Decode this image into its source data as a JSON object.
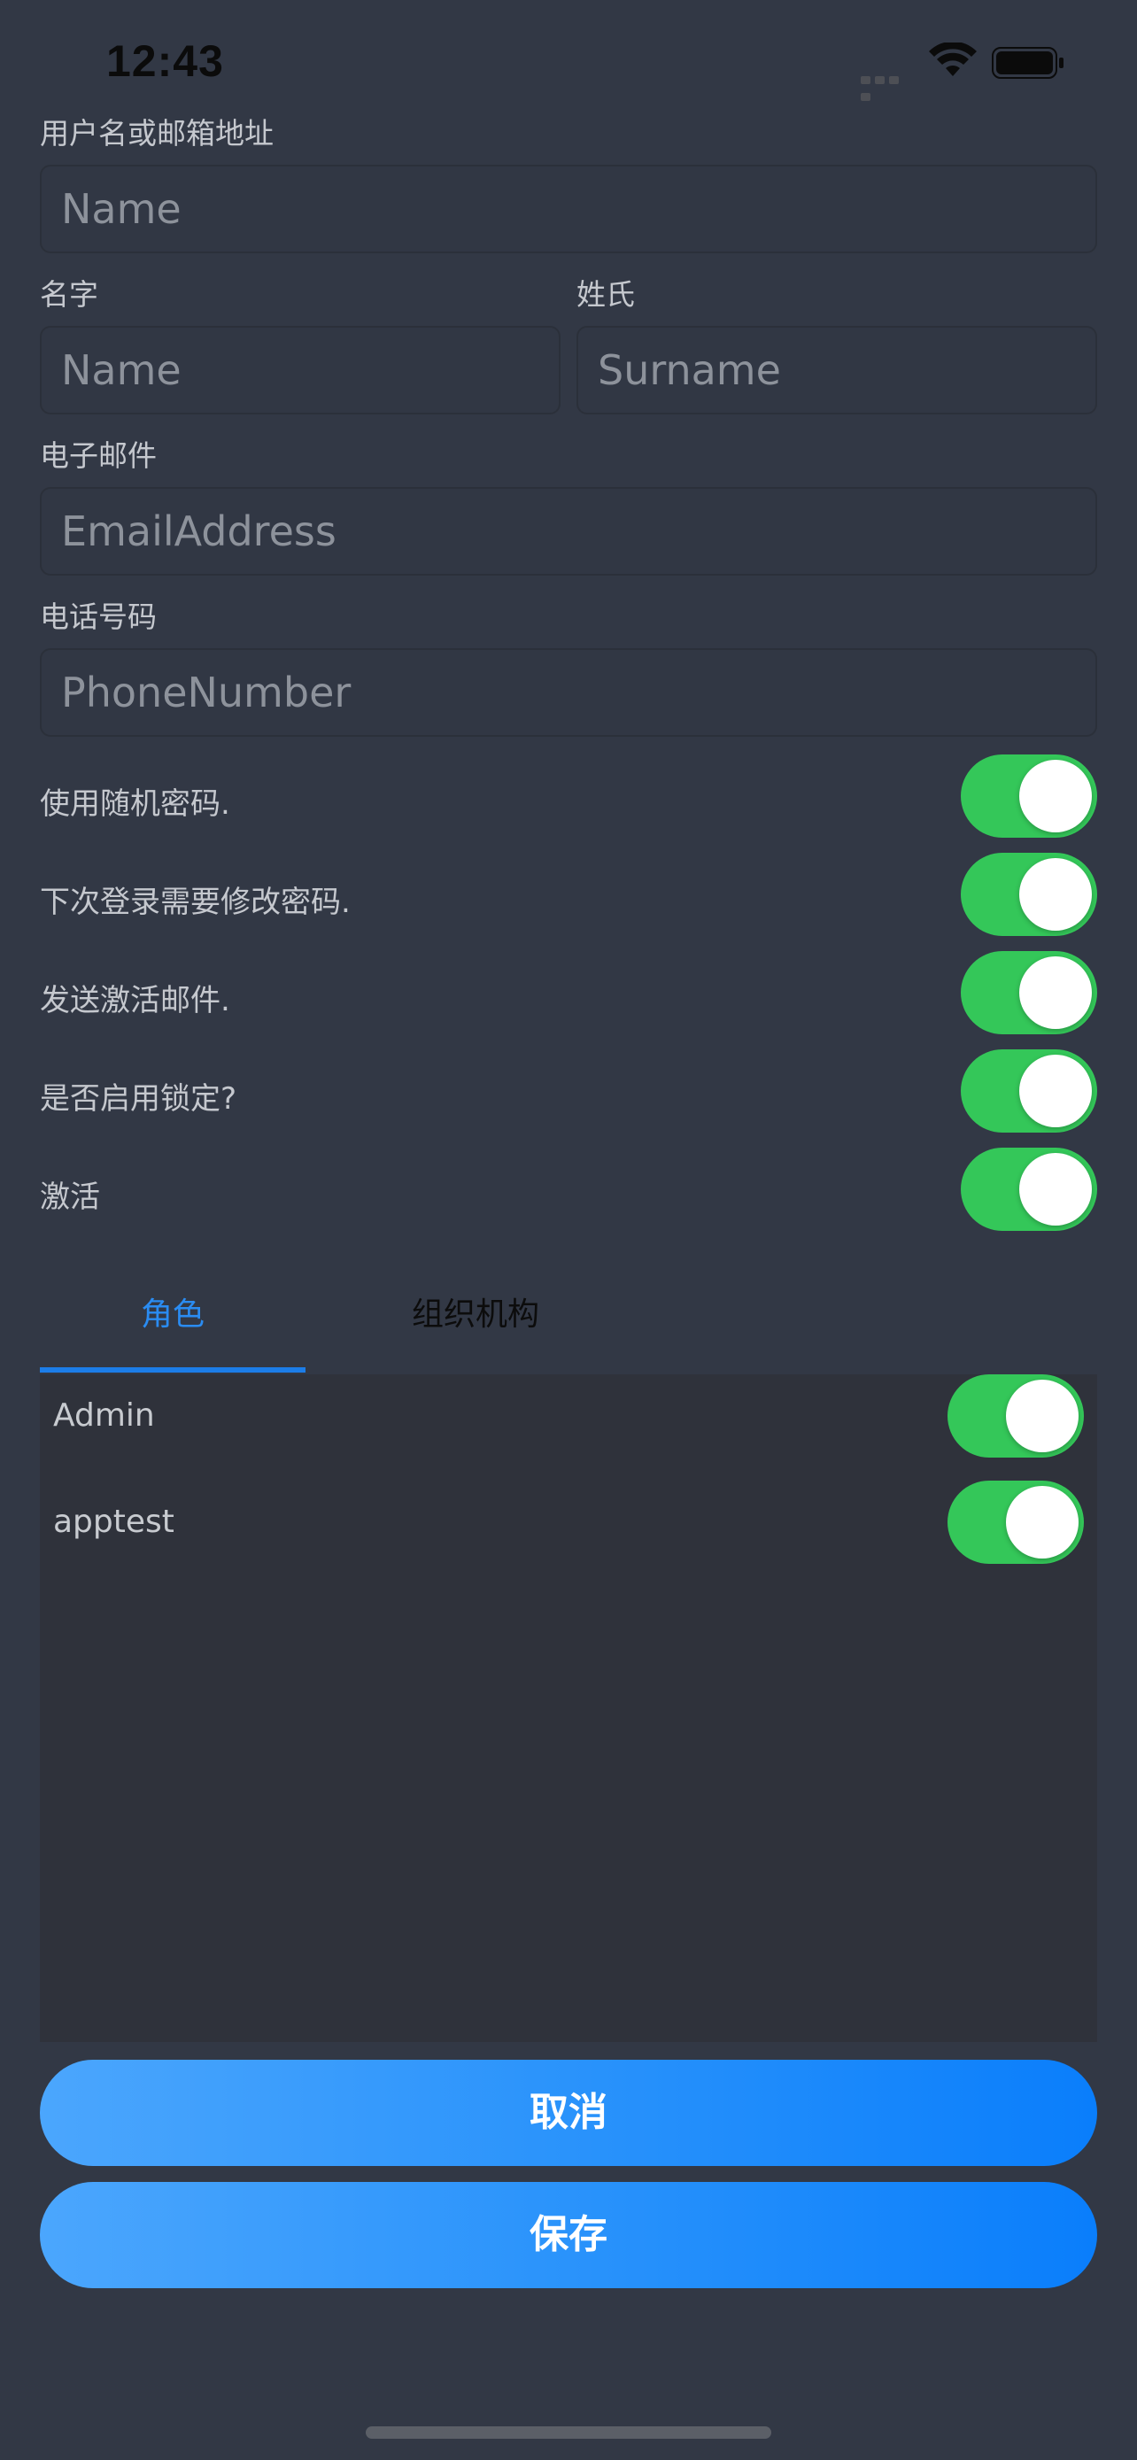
{
  "status_bar": {
    "time": "12:43"
  },
  "form": {
    "username": {
      "label": "用户名或邮箱地址",
      "placeholder": "Name"
    },
    "first_name": {
      "label": "名字",
      "placeholder": "Name"
    },
    "surname": {
      "label": "姓氏",
      "placeholder": "Surname"
    },
    "email": {
      "label": "电子邮件",
      "placeholder": "EmailAddress"
    },
    "phone": {
      "label": "电话号码",
      "placeholder": "PhoneNumber"
    }
  },
  "toggles": [
    {
      "label": "使用随机密码.",
      "on": true
    },
    {
      "label": "下次登录需要修改密码.",
      "on": true
    },
    {
      "label": "发送激活邮件.",
      "on": true
    },
    {
      "label": "是否启用锁定?",
      "on": true
    },
    {
      "label": "激活",
      "on": true
    }
  ],
  "tabs": {
    "roles": "角色",
    "org_units": "组织机构",
    "active": "roles"
  },
  "roles": [
    {
      "name": "Admin",
      "on": true
    },
    {
      "name": "apptest",
      "on": true
    }
  ],
  "buttons": {
    "cancel": "取消",
    "save": "保存"
  },
  "colors": {
    "background": "#323845",
    "switch_on": "#34c759",
    "accent": "#1c7de8",
    "button_gradient_start": "#4ba6fd",
    "button_gradient_end": "#0a7efb"
  }
}
